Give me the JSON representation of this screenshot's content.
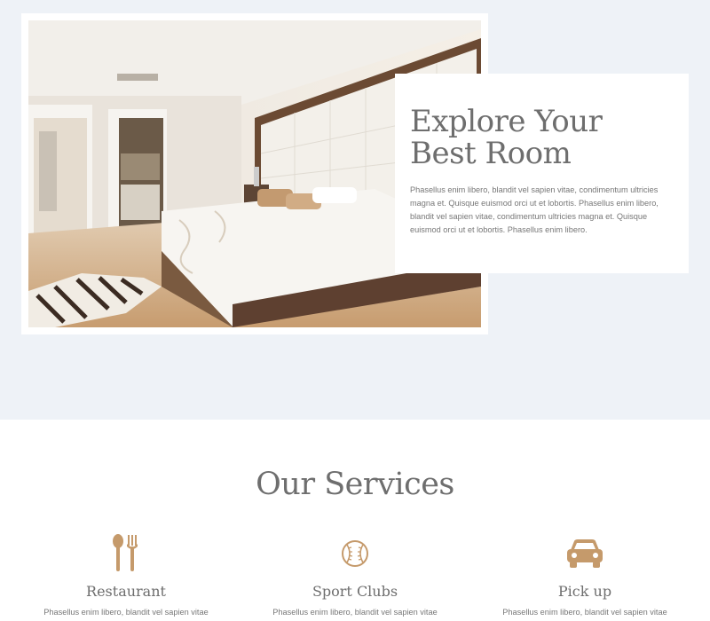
{
  "colors": {
    "hero_bg": "#eef2f7",
    "accent": "#c59a6b",
    "heading": "#6e6e6e",
    "body_text": "#777777"
  },
  "hero": {
    "image_alt": "Bedroom",
    "card": {
      "title": "Explore Your Best Room",
      "text": "Phasellus enim libero, blandit vel sapien vitae, condimentum ultricies magna et. Quisque euismod orci ut et lobortis. Phasellus enim libero, blandit vel sapien vitae, condimentum ultricies magna et. Quisque euismod orci ut et lobortis. Phasellus enim libero."
    }
  },
  "services": {
    "title": "Our Services",
    "items": [
      {
        "icon": "utensils-icon",
        "label": "Restaurant",
        "desc": "Phasellus enim libero, blandit vel sapien vitae"
      },
      {
        "icon": "baseball-icon",
        "label": "Sport Clubs",
        "desc": "Phasellus enim libero, blandit vel sapien vitae"
      },
      {
        "icon": "car-icon",
        "label": "Pick up",
        "desc": "Phasellus enim libero, blandit vel sapien vitae"
      }
    ]
  }
}
